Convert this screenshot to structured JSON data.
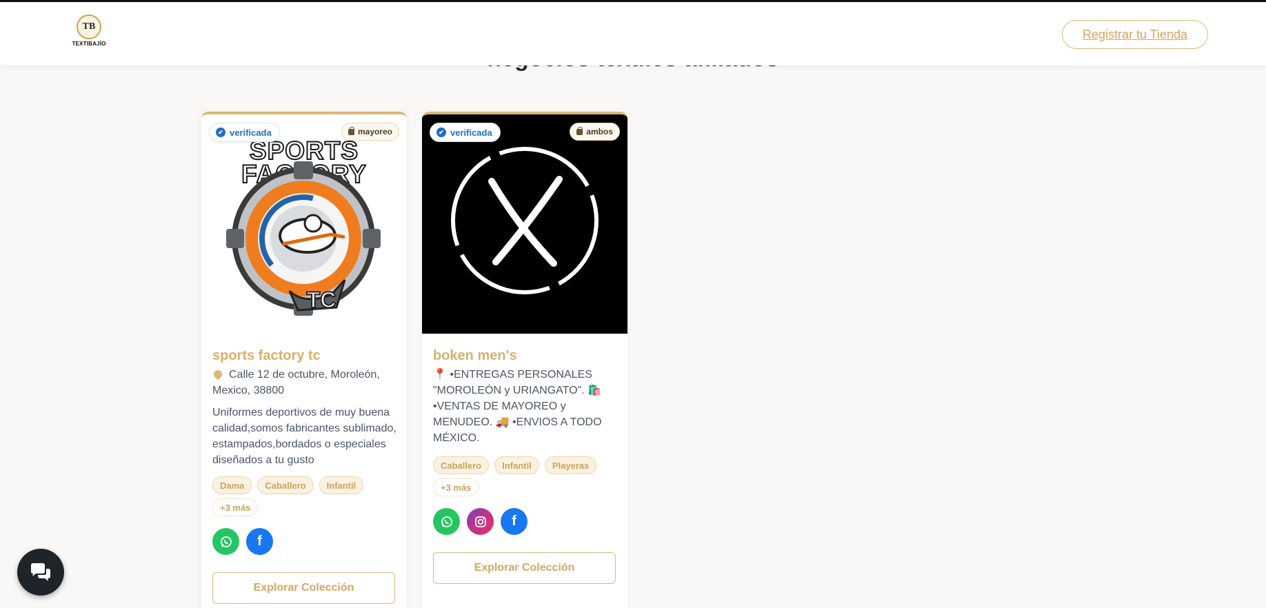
{
  "header": {
    "logo_text": "TEXTIBAJÍO",
    "logo_monogram": "TB",
    "register_label": "Registrar tu Tienda"
  },
  "section": {
    "title": "negocios textiles afiliados"
  },
  "cards": [
    {
      "verified_label": "verificada",
      "type_label": "mayoreo",
      "logo_text_line1": "SPORTS",
      "logo_text_line2": "FACTORY",
      "logo_text_line3": "TC",
      "name": "sports factory tc",
      "address": "Calle 12 de octubre, Moroleón, Mexico, 38800",
      "description": "Uniformes deportivos de muy buena calidad,somos fabricantes sublimado, estampados,bordados o especiales diseñados a tu gusto",
      "tags": [
        "Dama",
        "Caballero",
        "Infantil"
      ],
      "more_tags": "+3 más",
      "socials": [
        "whatsapp-icon",
        "facebook-icon"
      ],
      "explore_label": "Explorar Colección"
    },
    {
      "verified_label": "verificada",
      "type_label": "ambos",
      "name": "boken men's",
      "description": "📍 •ENTREGAS PERSONALES \"MOROLEÓN y URIANGATO\". 🛍️ •VENTAS DE MAYOREO y MENUDEO. 🚚 •ENVIOS A TODO MÉXICO.",
      "tags": [
        "Caballero",
        "Infantil",
        "Playeras"
      ],
      "more_tags": "+3 más",
      "socials": [
        "whatsapp-icon",
        "instagram-icon",
        "facebook-icon"
      ],
      "explore_label": "Explorar Colección"
    }
  ],
  "colors": {
    "accent": "#ddb878",
    "verified": "#1d6fc4",
    "whatsapp": "#25c661",
    "facebook": "#1877f2"
  }
}
